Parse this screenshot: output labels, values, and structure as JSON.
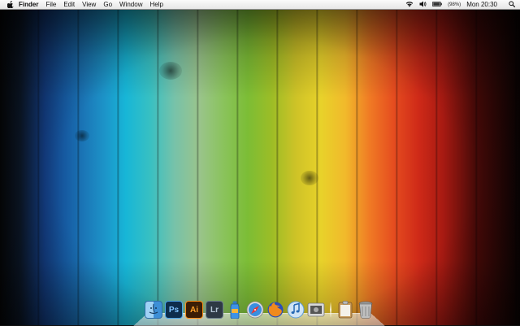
{
  "menubar": {
    "app_name": "Finder",
    "menus": [
      "File",
      "Edit",
      "View",
      "Go",
      "Window",
      "Help"
    ],
    "battery_percent": "(98%)",
    "clock": "Mon 20:30"
  },
  "icons": {
    "apple": "apple-logo-icon",
    "wifi": "wifi-icon",
    "volume": "volume-icon",
    "battery": "battery-icon",
    "spotlight": "spotlight-search-icon"
  },
  "dock": {
    "apps": [
      {
        "name": "Finder",
        "icon": "finder-icon"
      },
      {
        "name": "Photoshop",
        "label": "Ps",
        "icon": "photoshop-icon"
      },
      {
        "name": "Illustrator",
        "label": "Ai",
        "icon": "illustrator-icon"
      },
      {
        "name": "Lightroom",
        "label": "Lr",
        "icon": "lightroom-icon"
      },
      {
        "name": "Sequel",
        "icon": "water-bottle-icon"
      },
      {
        "name": "Safari",
        "icon": "safari-compass-icon"
      },
      {
        "name": "Firefox",
        "icon": "firefox-icon"
      },
      {
        "name": "iTunes",
        "icon": "itunes-note-icon"
      },
      {
        "name": "Preview",
        "icon": "preview-icon"
      }
    ],
    "stacks": [
      {
        "name": "Documents",
        "icon": "clipboard-icon"
      },
      {
        "name": "Trash",
        "icon": "trash-icon"
      }
    ]
  },
  "colors": {
    "menubar_bg": "#ececec",
    "wallpaper_left": "#123a7c",
    "wallpaper_center": "#7cbd35",
    "wallpaper_right": "#cf2a18"
  }
}
